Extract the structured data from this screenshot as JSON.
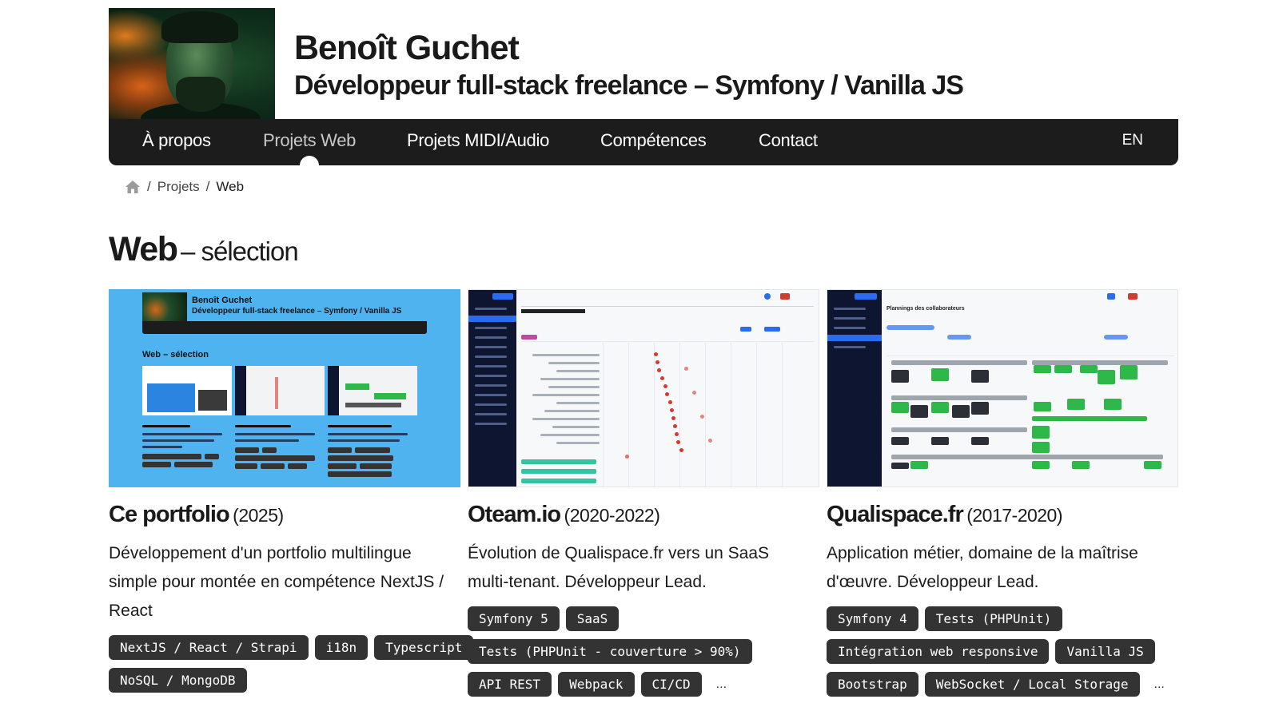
{
  "header": {
    "name": "Benoît Guchet",
    "tagline": "Développeur full-stack freelance – Symfony / Vanilla JS"
  },
  "nav": {
    "items": [
      {
        "label": "À propos"
      },
      {
        "label": "Projets Web",
        "active": true
      },
      {
        "label": "Projets MIDI/Audio"
      },
      {
        "label": "Compétences"
      },
      {
        "label": "Contact"
      }
    ],
    "lang": "EN"
  },
  "breadcrumb": {
    "home_icon": "home-icon",
    "separator": "/",
    "projects": "Projets",
    "current": "Web"
  },
  "section": {
    "title": "Web",
    "subtitle": "– sélection"
  },
  "projects": [
    {
      "title": "Ce portfolio",
      "years": "(2025)",
      "description": "Développement d'un portfolio multilingue simple pour montée en compétence NextJS / React",
      "tags": [
        "NextJS / React / Strapi",
        "i18n",
        "Typescript",
        "NoSQL / MongoDB"
      ],
      "more": ""
    },
    {
      "title": "Oteam.io",
      "years": "(2020-2022)",
      "description": "Évolution de Qualispace.fr vers un SaaS multi-tenant. Développeur Lead.",
      "tags": [
        "Symfony 5",
        "SaaS",
        "Tests (PHPUnit - couverture > 90%)",
        "API REST",
        "Webpack",
        "CI/CD"
      ],
      "more": "..."
    },
    {
      "title": "Qualispace.fr",
      "years": "(2017-2020)",
      "description": "Application métier, domaine de la maîtrise d'œuvre. Développeur Lead.",
      "tags": [
        "Symfony 4",
        "Tests (PHPUnit)",
        "Intégration web responsive",
        "Vanilla JS",
        "Bootstrap",
        "WebSocket / Local Storage"
      ],
      "more": "..."
    }
  ],
  "thumbs": {
    "portfolio": {
      "name": "Benoît Guchet",
      "tagline": "Développeur full-stack freelance – Symfony / Vanilla JS",
      "section": "Web – sélection"
    },
    "qualispace": {
      "heading": "Plannings des collaborateurs"
    }
  },
  "colors": {
    "nav_bg": "#1c1c1c",
    "tag_bg": "#333333",
    "portfolio_thumb_bg": "#4fb3f0",
    "app_sidebar": "#0d1530",
    "gantt_marker": "#d23b2f",
    "planning_green": "#2fb84a"
  }
}
